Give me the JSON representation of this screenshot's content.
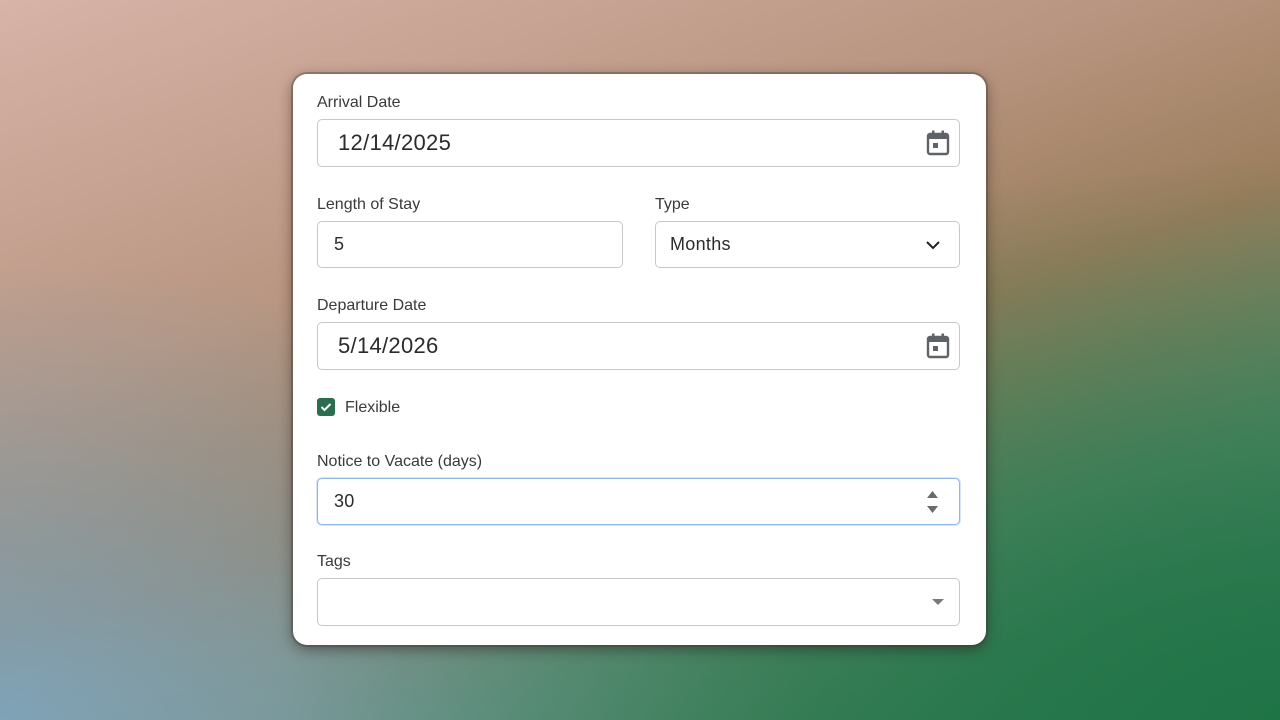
{
  "form": {
    "arrival": {
      "label": "Arrival Date",
      "value": "12/14/2025",
      "icon": "calendar-icon"
    },
    "length_of_stay": {
      "label": "Length of Stay",
      "value": "5"
    },
    "type": {
      "label": "Type",
      "selected": "Months",
      "icon": "chevron-down-icon"
    },
    "departure": {
      "label": "Departure Date",
      "value": "5/14/2026",
      "icon": "calendar-icon"
    },
    "flexible": {
      "label": "Flexible",
      "checked": true
    },
    "notice": {
      "label": "Notice to Vacate (days)",
      "value": "30",
      "icon": "spinner-arrows-icon"
    },
    "tags": {
      "label": "Tags",
      "value": "",
      "icon": "caret-down-icon"
    }
  },
  "colors": {
    "accent": "#2a6e4e",
    "focus": "#8fb6e6"
  }
}
